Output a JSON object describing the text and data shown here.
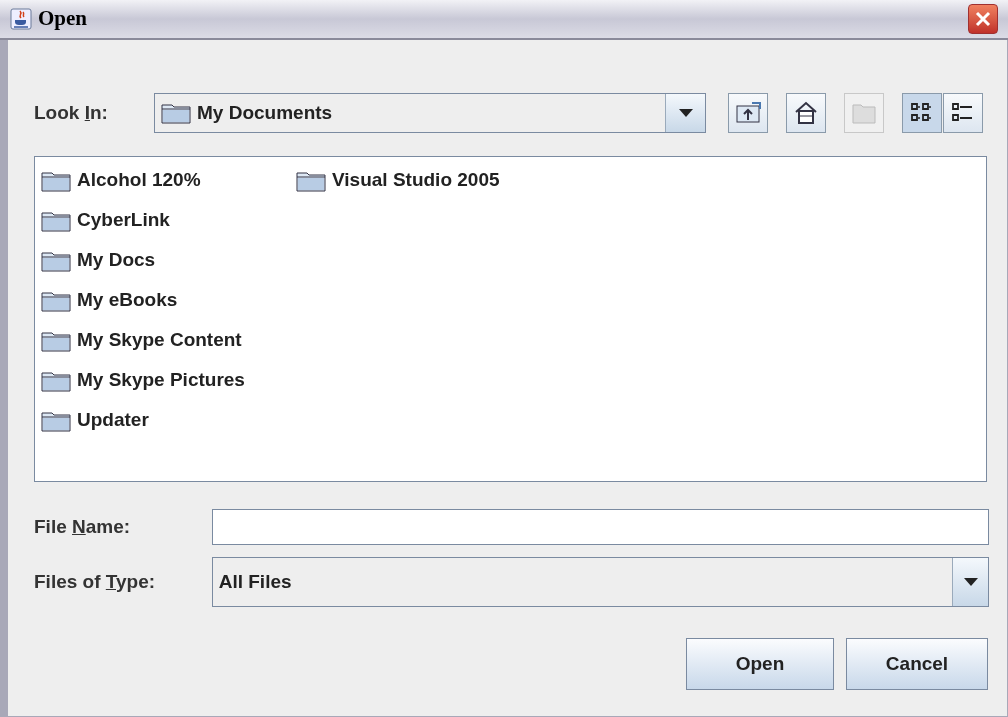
{
  "window": {
    "title": "Open"
  },
  "look_in": {
    "label": [
      {
        "text": "Look ",
        "underlined": false
      },
      {
        "text": "I",
        "underlined": true
      },
      {
        "text": "n:",
        "underlined": false
      }
    ],
    "value": "My Documents"
  },
  "toolbar": [
    {
      "kind": "up",
      "disabled": false
    },
    {
      "kind": "home",
      "disabled": false
    },
    {
      "kind": "new-folder",
      "disabled": true
    },
    {
      "kind": "list",
      "selected": true
    },
    {
      "kind": "details",
      "selected": false
    }
  ],
  "files": [
    {
      "name": "Alcohol 120%"
    },
    {
      "name": "CyberLink"
    },
    {
      "name": "My Docs"
    },
    {
      "name": "My eBooks"
    },
    {
      "name": "My Skype Content"
    },
    {
      "name": "My Skype Pictures"
    },
    {
      "name": "Updater"
    },
    {
      "name": "Visual Studio 2005"
    }
  ],
  "file_name": {
    "label": [
      {
        "text": "File ",
        "underlined": false
      },
      {
        "text": "N",
        "underlined": true
      },
      {
        "text": "ame:",
        "underlined": false
      }
    ]
  },
  "files_of_type": {
    "label": [
      {
        "text": "Files of ",
        "underlined": false
      },
      {
        "text": "T",
        "underlined": true
      },
      {
        "text": "ype:",
        "underlined": false
      }
    ],
    "value": "All Files"
  },
  "buttons": [
    "Open",
    "Cancel"
  ]
}
